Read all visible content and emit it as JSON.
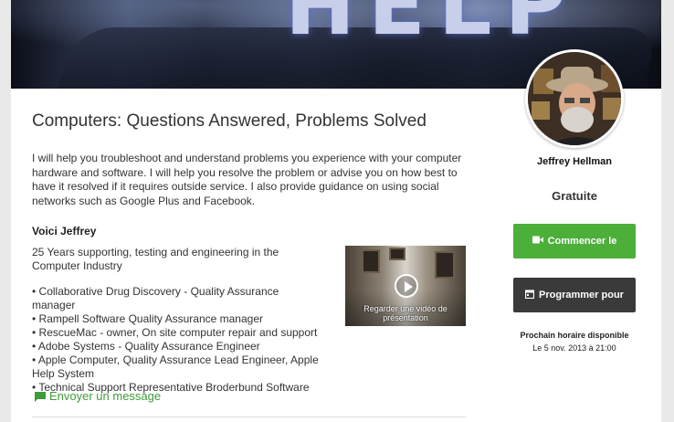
{
  "profile": {
    "title": "Computers: Questions Answered, Problems Solved",
    "description": "I will help you troubleshoot and understand problems you experience with your computer hardware and software. I will help you resolve the problem or advise you on how best to have it resolved if it requires outside service. I also provide guidance on using social networks such as Google Plus and Facebook.",
    "bio_heading": "Voici Jeffrey",
    "bio_intro": "25 Years supporting, testing and engineering in the Computer Industry",
    "bio_items": [
      "• Collaborative Drug Discovery - Quality Assurance  manager",
      "• Rampell Software  Quality Assurance  manager",
      "• RescueMac - owner, On site computer repair and support",
      "• Adobe Systems  - Quality Assurance Engineer",
      "• Apple Computer, Quality Assurance Lead Engineer, Apple Help System",
      "• Technical Support Representative Broderbund Software"
    ],
    "message_link": "Envoyer un message"
  },
  "video": {
    "caption": "Regarder une vidéo de présentation"
  },
  "sidebar": {
    "tutor_name": "Jeffrey Hellman",
    "price": "Gratuite",
    "start_button": "Commencer le",
    "schedule_button": "Programmer pour",
    "next_slot_label": "Prochain horaire disponible",
    "next_slot_date": "Le 5 nov. 2013 à 21:00"
  },
  "colors": {
    "accent_green": "#4caf3a",
    "dark_button": "#3a3a3a",
    "link_green": "#3e9c3a"
  },
  "icons": {
    "start": "video-camera-icon",
    "schedule": "calendar-icon",
    "message": "chat-bubble-icon",
    "video": "play-icon"
  }
}
